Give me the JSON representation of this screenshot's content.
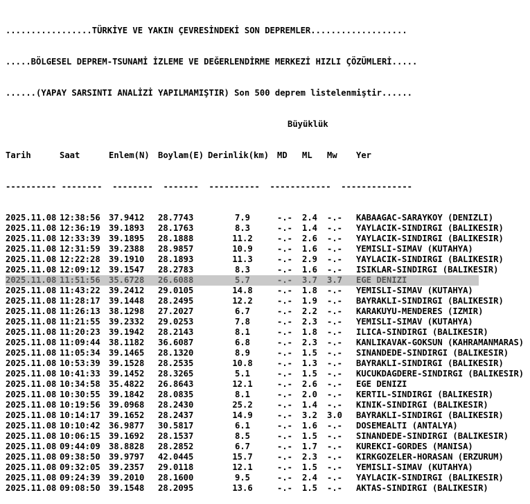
{
  "header": {
    "line1": ".................TÜRKİYE VE YAKIN ÇEVRESİNDEKİ SON DEPREMLER...................",
    "line2": ".....BÖLGESEL DEPREM-TSUNAMİ İZLEME VE DEĞERLENDİRME MERKEZİ HIZLI ÇÖZÜMLERİ.....",
    "line3": "......(YAPAY SARSINTI ANALİZİ YAPILMAMIŞTIR) Son 500 deprem listelenmiştir......"
  },
  "columns": {
    "magnitude_group": "Büyüklük",
    "date": "Tarih",
    "time": "Saat",
    "lat": "Enlem(N)",
    "lon": "Boylam(E)",
    "depth": "Derinlik(km)",
    "md": "MD",
    "ml": "ML",
    "mw": "Mw",
    "location": "Yer"
  },
  "separator": "---------- --------  --------  -------  ----------  ------------  --------------",
  "selected_row_index": 6,
  "rows": [
    {
      "date": "2025.11.08",
      "time": "12:38:56",
      "lat": "37.9412",
      "lon": "28.7743",
      "depth": "7.9",
      "md": "-.-",
      "ml": "2.4",
      "mw": "-.-",
      "location": "KABAAGAC-SARAYKOY (DENIZLI)"
    },
    {
      "date": "2025.11.08",
      "time": "12:36:19",
      "lat": "39.1893",
      "lon": "28.1763",
      "depth": "8.3",
      "md": "-.-",
      "ml": "1.4",
      "mw": "-.-",
      "location": "YAYLACIK-SINDIRGI (BALIKESIR)"
    },
    {
      "date": "2025.11.08",
      "time": "12:33:39",
      "lat": "39.1895",
      "lon": "28.1888",
      "depth": "11.2",
      "md": "-.-",
      "ml": "2.6",
      "mw": "-.-",
      "location": "YAYLACIK-SINDIRGI (BALIKESIR)"
    },
    {
      "date": "2025.11.08",
      "time": "12:31:59",
      "lat": "39.2388",
      "lon": "28.9857",
      "depth": "10.9",
      "md": "-.-",
      "ml": "1.6",
      "mw": "-.-",
      "location": "YEMISLI-SIMAV (KUTAHYA)"
    },
    {
      "date": "2025.11.08",
      "time": "12:22:28",
      "lat": "39.1910",
      "lon": "28.1893",
      "depth": "11.3",
      "md": "-.-",
      "ml": "2.9",
      "mw": "-.-",
      "location": "YAYLACIK-SINDIRGI (BALIKESIR)"
    },
    {
      "date": "2025.11.08",
      "time": "12:09:12",
      "lat": "39.1547",
      "lon": "28.2783",
      "depth": "8.3",
      "md": "-.-",
      "ml": "1.6",
      "mw": "-.-",
      "location": "ISIKLAR-SINDIRGI (BALIKESIR)"
    },
    {
      "date": "2025.11.08",
      "time": "11:51:56",
      "lat": "35.6728",
      "lon": "26.6088",
      "depth": "5.7",
      "md": "-.-",
      "ml": "3.7",
      "mw": "3.7",
      "location": "EGE DENIZI"
    },
    {
      "date": "2025.11.08",
      "time": "11:43:22",
      "lat": "39.2412",
      "lon": "29.0105",
      "depth": "14.8",
      "md": "-.-",
      "ml": "1.8",
      "mw": "-.-",
      "location": "YEMISLI-SIMAV (KUTAHYA)"
    },
    {
      "date": "2025.11.08",
      "time": "11:28:17",
      "lat": "39.1448",
      "lon": "28.2495",
      "depth": "12.2",
      "md": "-.-",
      "ml": "1.9",
      "mw": "-.-",
      "location": "BAYRAKLI-SINDIRGI (BALIKESIR)"
    },
    {
      "date": "2025.11.08",
      "time": "11:26:13",
      "lat": "38.1298",
      "lon": "27.2027",
      "depth": "6.7",
      "md": "-.-",
      "ml": "2.2",
      "mw": "-.-",
      "location": "KARAKUYU-MENDERES (IZMIR)"
    },
    {
      "date": "2025.11.08",
      "time": "11:21:55",
      "lat": "39.2332",
      "lon": "29.0253",
      "depth": "7.8",
      "md": "-.-",
      "ml": "2.3",
      "mw": "-.-",
      "location": "YEMISLI-SIMAV (KUTAHYA)"
    },
    {
      "date": "2025.11.08",
      "time": "11:20:23",
      "lat": "39.1942",
      "lon": "28.2143",
      "depth": "8.1",
      "md": "-.-",
      "ml": "1.8",
      "mw": "-.-",
      "location": "ILICA-SINDIRGI (BALIKESIR)"
    },
    {
      "date": "2025.11.08",
      "time": "11:09:44",
      "lat": "38.1182",
      "lon": "36.6087",
      "depth": "6.8",
      "md": "-.-",
      "ml": "2.3",
      "mw": "-.-",
      "location": "KANLIKAVAK-GOKSUN (KAHRAMANMARAS)"
    },
    {
      "date": "2025.11.08",
      "time": "11:05:34",
      "lat": "39.1465",
      "lon": "28.1320",
      "depth": "8.9",
      "md": "-.-",
      "ml": "1.5",
      "mw": "-.-",
      "location": "SINANDEDE-SINDIRGI (BALIKESIR)"
    },
    {
      "date": "2025.11.08",
      "time": "10:53:39",
      "lat": "39.1528",
      "lon": "28.2535",
      "depth": "10.8",
      "md": "-.-",
      "ml": "1.3",
      "mw": "-.-",
      "location": "BAYRAKLI-SINDIRGI (BALIKESIR)"
    },
    {
      "date": "2025.11.08",
      "time": "10:41:33",
      "lat": "39.1452",
      "lon": "28.3265",
      "depth": "5.1",
      "md": "-.-",
      "ml": "1.5",
      "mw": "-.-",
      "location": "KUCUKDAGDERE-SINDIRGI (BALIKESIR)"
    },
    {
      "date": "2025.11.08",
      "time": "10:34:58",
      "lat": "35.4822",
      "lon": "26.8643",
      "depth": "12.1",
      "md": "-.-",
      "ml": "2.6",
      "mw": "-.-",
      "location": "EGE DENIZI"
    },
    {
      "date": "2025.11.08",
      "time": "10:30:55",
      "lat": "39.1842",
      "lon": "28.0835",
      "depth": "8.1",
      "md": "-.-",
      "ml": "2.0",
      "mw": "-.-",
      "location": "KERTIL-SINDIRGI (BALIKESIR)"
    },
    {
      "date": "2025.11.08",
      "time": "10:19:56",
      "lat": "39.0968",
      "lon": "28.2430",
      "depth": "25.2",
      "md": "-.-",
      "ml": "1.4",
      "mw": "-.-",
      "location": "KINIK-SINDIRGI (BALIKESIR)"
    },
    {
      "date": "2025.11.08",
      "time": "10:14:17",
      "lat": "39.1652",
      "lon": "28.2437",
      "depth": "14.9",
      "md": "-.-",
      "ml": "3.2",
      "mw": "3.0",
      "location": "BAYRAKLI-SINDIRGI (BALIKESIR)"
    },
    {
      "date": "2025.11.08",
      "time": "10:10:42",
      "lat": "36.9877",
      "lon": "30.5817",
      "depth": "6.1",
      "md": "-.-",
      "ml": "1.6",
      "mw": "-.-",
      "location": "DOSEMEALTI (ANTALYA)"
    },
    {
      "date": "2025.11.08",
      "time": "10:06:15",
      "lat": "39.1692",
      "lon": "28.1537",
      "depth": "8.5",
      "md": "-.-",
      "ml": "1.5",
      "mw": "-.-",
      "location": "SINANDEDE-SINDIRGI (BALIKESIR)"
    },
    {
      "date": "2025.11.08",
      "time": "09:44:09",
      "lat": "38.8828",
      "lon": "28.2852",
      "depth": "6.7",
      "md": "-.-",
      "ml": "1.7",
      "mw": "-.-",
      "location": "KUREKCI-GORDES (MANISA)"
    },
    {
      "date": "2025.11.08",
      "time": "09:38:50",
      "lat": "39.9797",
      "lon": "42.0445",
      "depth": "15.7",
      "md": "-.-",
      "ml": "2.3",
      "mw": "-.-",
      "location": "KIRKGOZELER-HORASAN (ERZURUM)"
    },
    {
      "date": "2025.11.08",
      "time": "09:32:05",
      "lat": "39.2357",
      "lon": "29.0118",
      "depth": "12.1",
      "md": "-.-",
      "ml": "1.5",
      "mw": "-.-",
      "location": "YEMISLI-SIMAV (KUTAHYA)"
    },
    {
      "date": "2025.11.08",
      "time": "09:24:39",
      "lat": "39.2010",
      "lon": "28.1600",
      "depth": "9.5",
      "md": "-.-",
      "ml": "2.4",
      "mw": "-.-",
      "location": "YAYLACIK-SINDIRGI (BALIKESIR)"
    },
    {
      "date": "2025.11.08",
      "time": "09:08:50",
      "lat": "39.1548",
      "lon": "28.2095",
      "depth": "13.6",
      "md": "-.-",
      "ml": "1.5",
      "mw": "-.-",
      "location": "AKTAS-SINDIRGI (BALIKESIR)"
    }
  ]
}
